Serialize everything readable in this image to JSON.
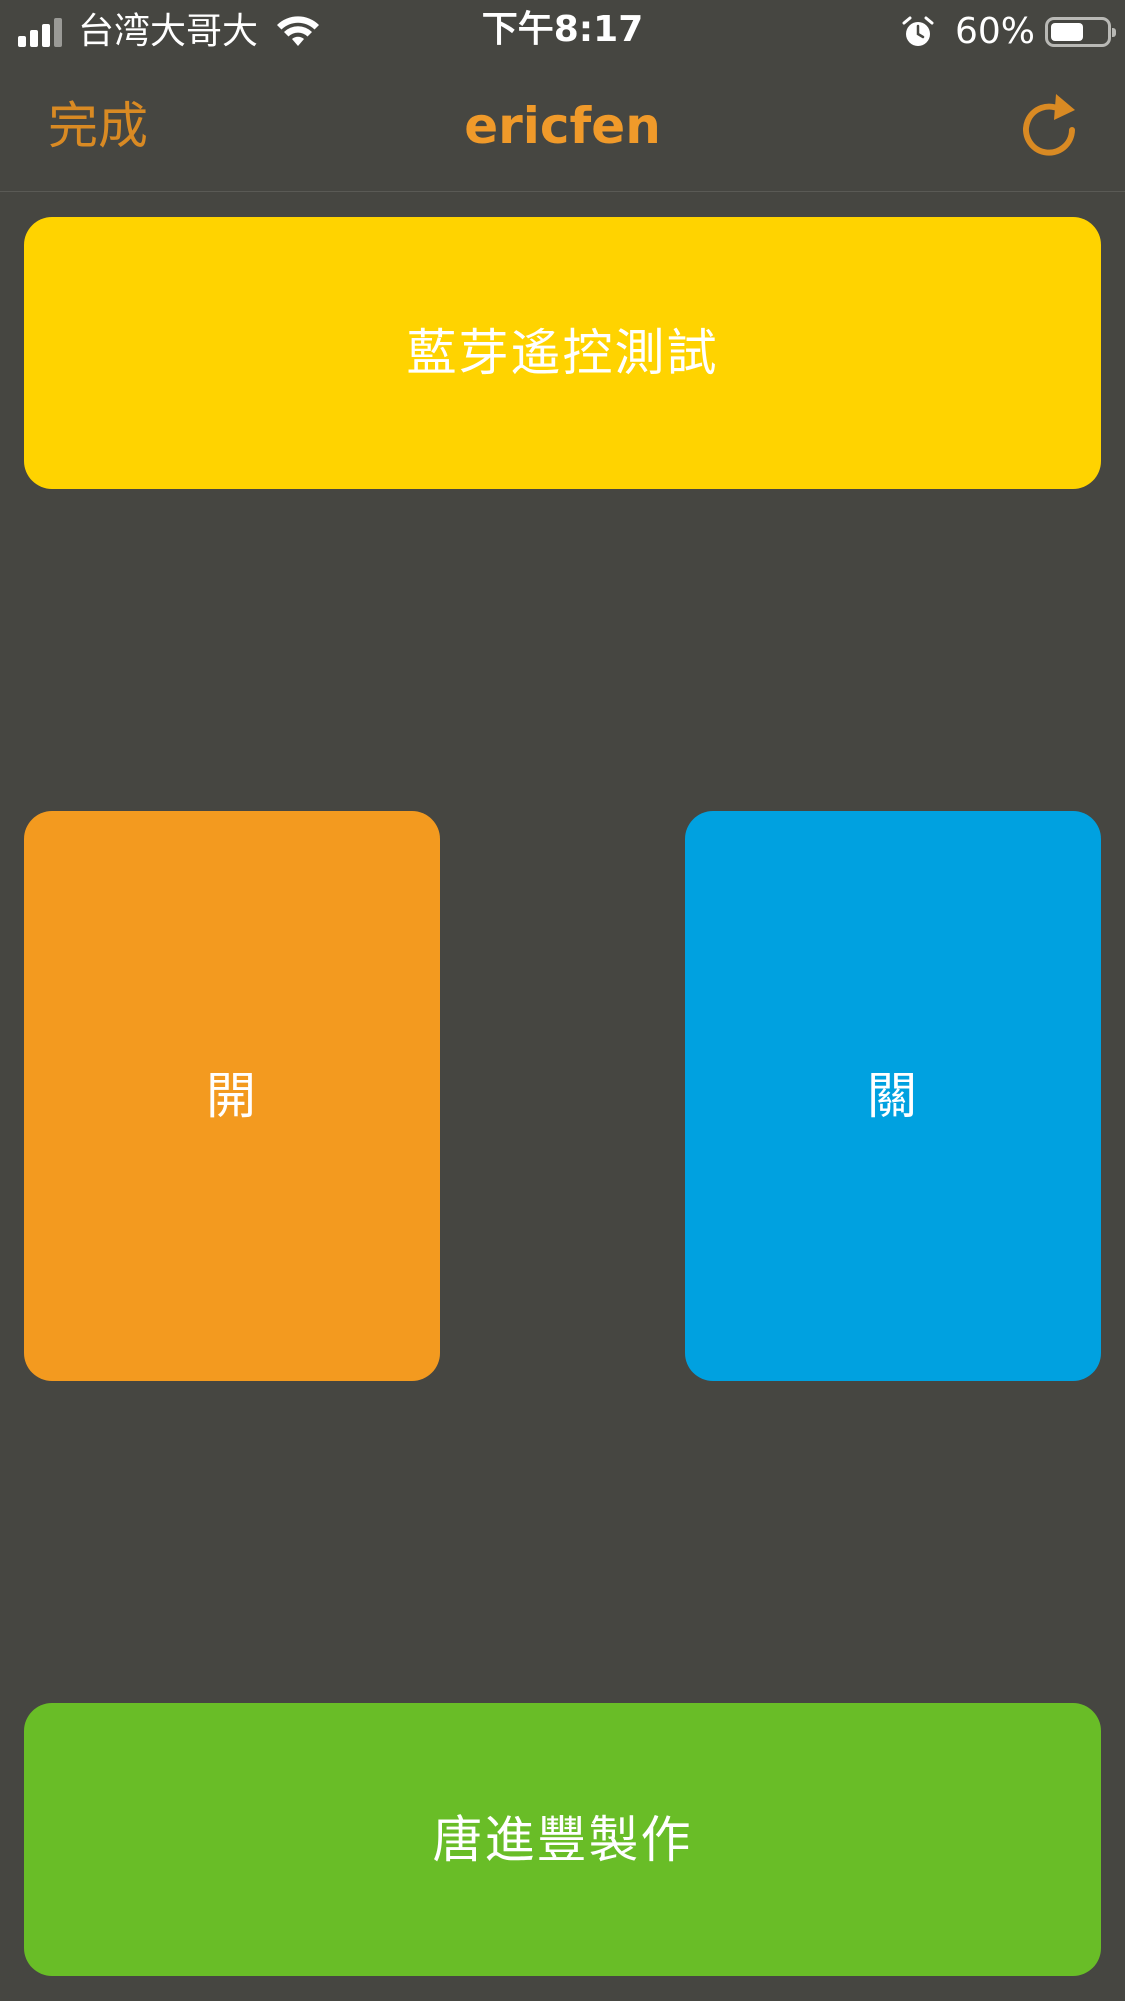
{
  "status_bar": {
    "carrier": "台湾大哥大",
    "time": "下午8:17",
    "battery_percent": "60%",
    "battery_level": 0.6,
    "signal_bars": 3,
    "signal_bars_total": 4,
    "icons": [
      "signal-icon",
      "wifi-icon",
      "alarm-icon",
      "battery-icon"
    ]
  },
  "nav": {
    "done_label": "完成",
    "title": "ericfen",
    "refresh_icon": "refresh-icon"
  },
  "buttons": {
    "test": {
      "label": "藍芽遙控測試",
      "color": "#ffd300"
    },
    "on": {
      "label": "開",
      "color": "#f39a1f"
    },
    "off": {
      "label": "關",
      "color": "#00a1e0"
    },
    "credit": {
      "label": "唐進豐製作",
      "color": "#69bd27"
    }
  },
  "colors": {
    "background": "#464641",
    "accent": "#f09a2a"
  }
}
